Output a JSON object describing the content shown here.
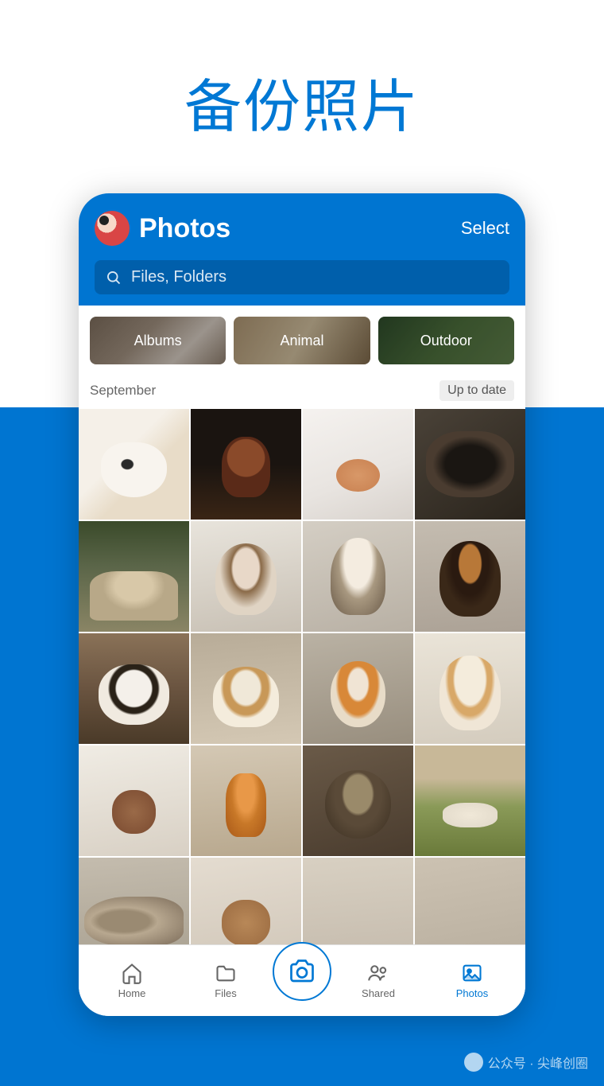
{
  "headline": "备份照片",
  "header": {
    "title": "Photos",
    "select_label": "Select"
  },
  "search": {
    "placeholder": "Files, Folders"
  },
  "categories": [
    {
      "label": "Albums"
    },
    {
      "label": "Animal"
    },
    {
      "label": "Outdoor"
    }
  ],
  "month": {
    "label": "September",
    "status": "Up to date"
  },
  "nav": {
    "home": "Home",
    "files": "Files",
    "shared": "Shared",
    "photos": "Photos"
  },
  "watermark": "公众号 · 尖峰创圈",
  "colors": {
    "primary": "#0078d4",
    "header_bg": "#0075d1"
  }
}
